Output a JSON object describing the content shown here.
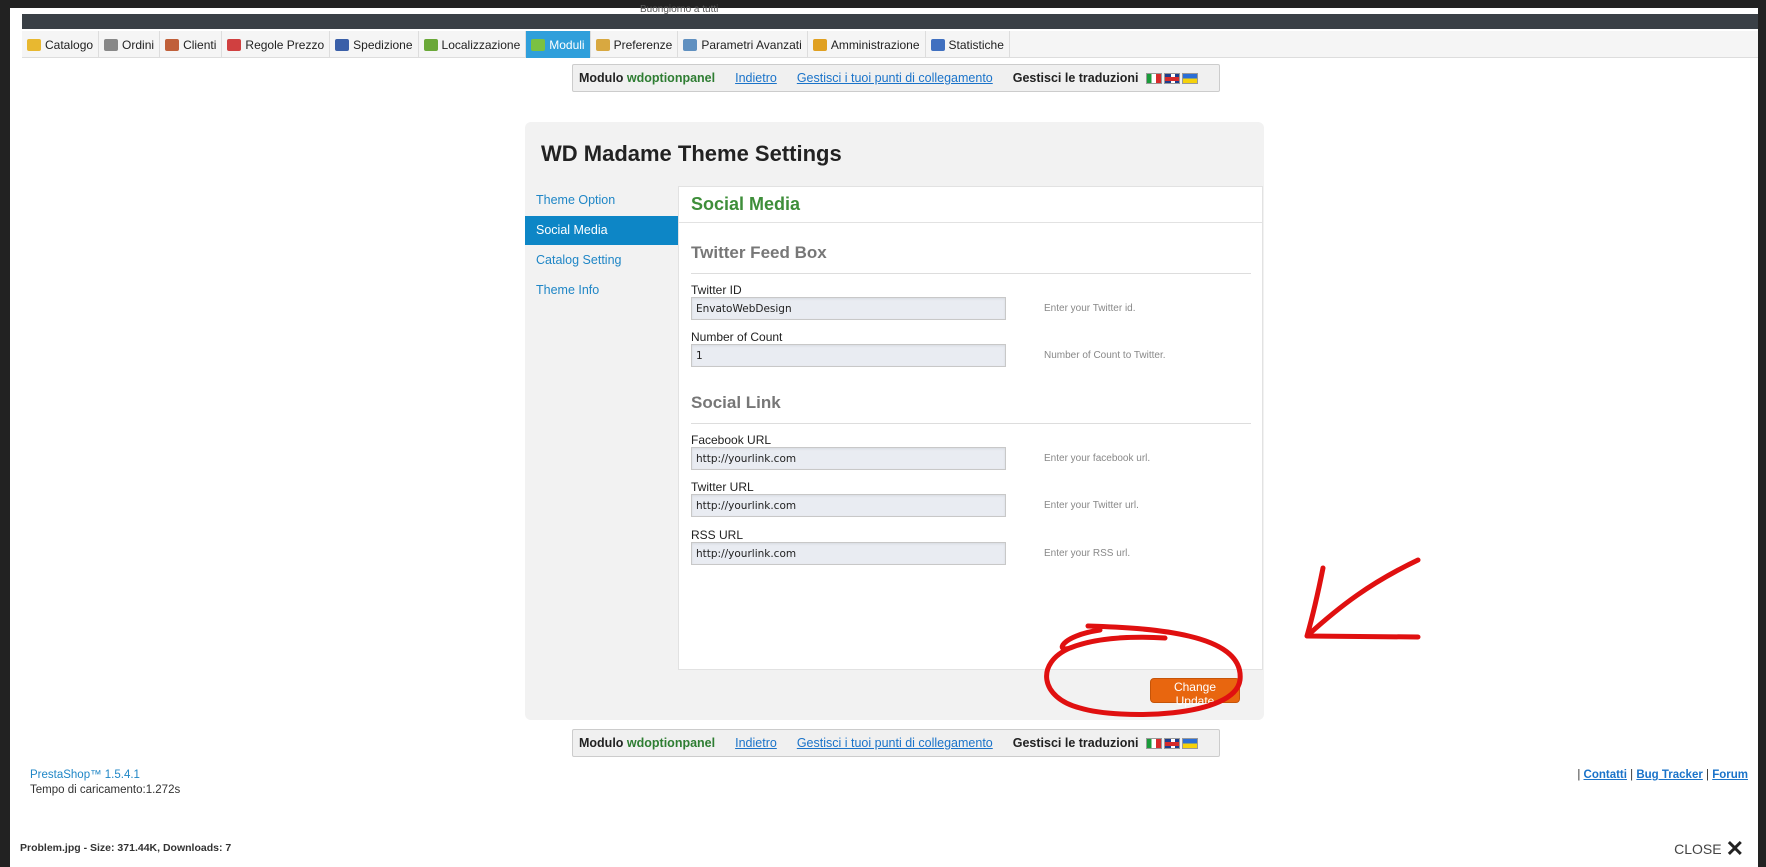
{
  "clip_text": "Buongiorno a tutti",
  "tabs": [
    {
      "label": "Catalogo",
      "icon": "folder-icon",
      "color": "#e8b830"
    },
    {
      "label": "Ordini",
      "icon": "cart-icon",
      "color": "#888888"
    },
    {
      "label": "Clienti",
      "icon": "person-icon",
      "color": "#c0603a"
    },
    {
      "label": "Regole Prezzo",
      "icon": "price-rules-icon",
      "color": "#d04040"
    },
    {
      "label": "Spedizione",
      "icon": "truck-icon",
      "color": "#3a5fa8"
    },
    {
      "label": "Localizzazione",
      "icon": "globe-icon",
      "color": "#6aa838"
    },
    {
      "label": "Moduli",
      "icon": "puzzle-icon",
      "color": "#7ac142"
    },
    {
      "label": "Preferenze",
      "icon": "preferences-icon",
      "color": "#d8a840"
    },
    {
      "label": "Parametri Avanzati",
      "icon": "wrench-icon",
      "color": "#6090c0"
    },
    {
      "label": "Amministrazione",
      "icon": "key-icon",
      "color": "#e0a020"
    },
    {
      "label": "Statistiche",
      "icon": "bar-chart-icon",
      "color": "#4070c0"
    }
  ],
  "active_tab": "Moduli",
  "modbar": {
    "module_prefix": "Modulo",
    "module_name": "wdoptionpanel",
    "back_link": "Indietro",
    "hooks_link": "Gestisci i tuoi punti di collegamento",
    "translations_label": "Gestisci le traduzioni"
  },
  "panel": {
    "title": "WD Madame Theme Settings",
    "nav": [
      {
        "label": "Theme Option"
      },
      {
        "label": "Social Media"
      },
      {
        "label": "Catalog Setting"
      },
      {
        "label": "Theme Info"
      }
    ],
    "active_nav": "Social Media",
    "content_title": "Social Media",
    "sections": {
      "twitter_feed": {
        "title": "Twitter Feed Box",
        "twitter_id": {
          "label": "Twitter ID",
          "value": "EnvatoWebDesign",
          "help": "Enter your Twitter id."
        },
        "count": {
          "label": "Number of Count",
          "value": "1",
          "help": "Number of Count to Twitter."
        }
      },
      "social_link": {
        "title": "Social Link",
        "facebook": {
          "label": "Facebook URL",
          "value": "http://yourlink.com",
          "help": "Enter your facebook url."
        },
        "twitter": {
          "label": "Twitter URL",
          "value": "http://yourlink.com",
          "help": "Enter your Twitter url."
        },
        "rss": {
          "label": "RSS URL",
          "value": "http://yourlink.com",
          "help": "Enter your RSS url."
        }
      }
    },
    "submit_label": "Change Update"
  },
  "footer": {
    "version": "PrestaShop™ 1.5.4.1",
    "load_time": "Tempo di caricamento:1.272s",
    "links": [
      "Contatti",
      "Bug Tracker",
      "Forum"
    ]
  },
  "viewer": {
    "file_info": "Problem.jpg - Size: 371.44K, Downloads: 7",
    "close_label": "CLOSE"
  },
  "colors": {
    "accent_blue": "#0d86c6",
    "green_title": "#3e8e3a",
    "orange_button": "#e8660f",
    "annotation_red": "#e01010"
  }
}
